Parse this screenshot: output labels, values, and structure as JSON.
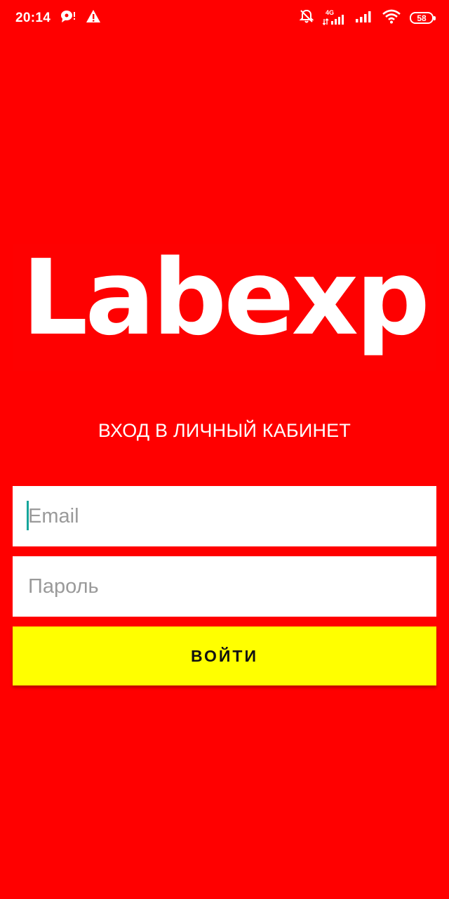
{
  "status_bar": {
    "time": "20:14",
    "network": "4G",
    "battery": "58",
    "icons": [
      "chat-icon",
      "warning-icon",
      "mute-icon",
      "signal-4g-icon",
      "signal-icon",
      "wifi-icon",
      "battery-icon"
    ]
  },
  "logo": {
    "text": "Labexp"
  },
  "login": {
    "title": "ВХОД В ЛИЧНЫЙ КАБИНЕТ",
    "email_placeholder": "Email",
    "password_placeholder": "Пароль",
    "submit_label": "ВОЙТИ"
  },
  "colors": {
    "background": "#ff0000",
    "button": "#ffff00",
    "cursor": "#16a59b"
  }
}
